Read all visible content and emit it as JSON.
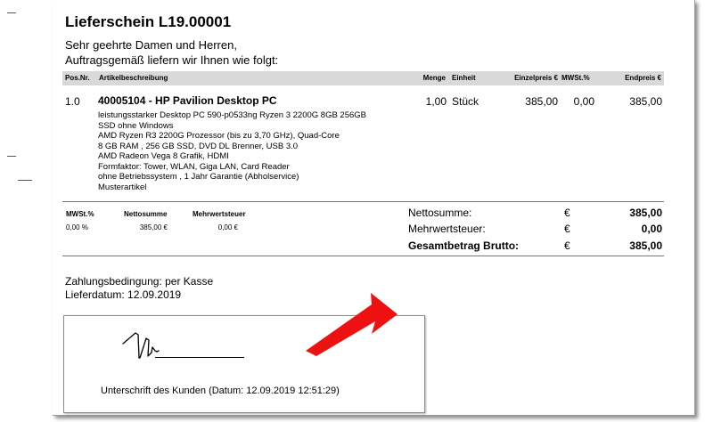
{
  "document": {
    "title": "Lieferschein L19.00001",
    "greeting": "Sehr geehrte Damen und Herren,",
    "intro": "Auftragsgemäß liefern wir Ihnen wie folgt:"
  },
  "table": {
    "headers": {
      "pos": "Pos.Nr.",
      "desc": "Artikelbeschreibung",
      "qty": "Menge",
      "unit": "Einheit",
      "unit_price": "Einzelpreis €",
      "vat": "MWSt.%",
      "total": "Endpreis €"
    },
    "rows": [
      {
        "pos": "1.0",
        "title": "40005104 - HP Pavilion Desktop PC",
        "description": [
          "leistungsstarker Desktop PC 590-p0533ng Ryzen 3 2200G 8GB 256GB",
          "SSD ohne Windows",
          "AMD Ryzen R3 2200G Prozessor (bis zu 3,70 GHz), Quad-Core",
          "8 GB RAM , 256 GB SSD, DVD DL Brenner, USB 3.0",
          "AMD Radeon Vega 8 Grafik, HDMI",
          "Formfaktor: Tower, WLAN, Giga LAN, Card Reader",
          "ohne Betriebssystem , 1 Jahr Garantie (Abholservice)",
          "Musterartikel"
        ],
        "qty": "1,00",
        "unit": "Stück",
        "unit_price": "385,00",
        "vat": "0,00",
        "total": "385,00"
      }
    ]
  },
  "vat_summary": {
    "headers": {
      "rate": "MWSt.%",
      "net": "Nettosumme",
      "tax": "Mehrwertsteuer"
    },
    "row": {
      "rate": "0,00 %",
      "net": "385,00 €",
      "tax": "0,00 €"
    }
  },
  "totals": {
    "net_label": "Nettosumme:",
    "net_currency": "€",
    "net_value": "385,00",
    "tax_label": "Mehrwertsteuer:",
    "tax_currency": "€",
    "tax_value": "0,00",
    "gross_label": "Gesamtbetrag Brutto:",
    "gross_currency": "€",
    "gross_value": "385,00"
  },
  "footer": {
    "payment": "Zahlungsbedingung: per Kasse",
    "delivery_date": "Lieferdatum: 12.09.2019",
    "signature_label": "Unterschrift des Kunden (Datum: 12.09.2019 12:51:29)"
  },
  "colors": {
    "arrow": "#ee1111",
    "table_header_bg": "#d9d9d9"
  }
}
